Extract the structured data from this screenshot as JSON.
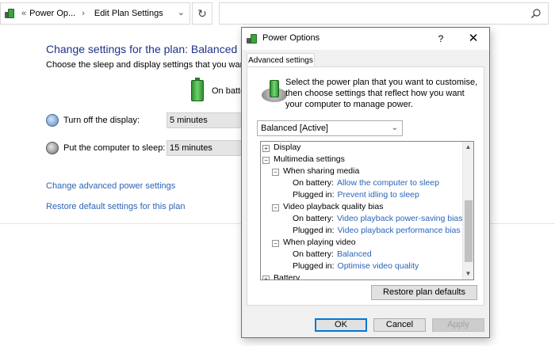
{
  "address_bar": {
    "breadcrumb_overflow": "«",
    "breadcrumb_parent": "Power Op...",
    "breadcrumb_sep": "›",
    "breadcrumb_current": "Edit Plan Settings",
    "dropdown_glyph": "⌄",
    "refresh_glyph": "↻"
  },
  "plan": {
    "title": "Change settings for the plan: Balanced",
    "subtitle": "Choose the sleep and display settings that you want yo",
    "on_battery_label": "On batte",
    "display_label": "Turn off the display:",
    "display_value": "5 minutes",
    "sleep_label": "Put the computer to sleep:",
    "sleep_value": "15 minutes",
    "advanced_link": "Change advanced power settings",
    "restore_link": "Restore default settings for this plan"
  },
  "dialog": {
    "title": "Power Options",
    "help_glyph": "?",
    "close_glyph": "✕",
    "tab": "Advanced settings",
    "intro": "Select the power plan that you want to customise, then choose settings that reflect how you want your computer to manage power.",
    "plan_selected": "Balanced [Active]",
    "plan_dropdown_glyph": "⌄",
    "tree": [
      {
        "level": 0,
        "expander": "+",
        "label": "Display",
        "value": ""
      },
      {
        "level": 0,
        "expander": "−",
        "label": "Multimedia settings",
        "value": ""
      },
      {
        "level": 1,
        "expander": "−",
        "label": "When sharing media",
        "value": ""
      },
      {
        "level": 2,
        "expander": "",
        "label": "On battery:",
        "value": "Allow the computer to sleep"
      },
      {
        "level": 2,
        "expander": "",
        "label": "Plugged in:",
        "value": "Prevent idling to sleep"
      },
      {
        "level": 1,
        "expander": "−",
        "label": "Video playback quality bias",
        "value": ""
      },
      {
        "level": 2,
        "expander": "",
        "label": "On battery:",
        "value": "Video playback power-saving bias"
      },
      {
        "level": 2,
        "expander": "",
        "label": "Plugged in:",
        "value": "Video playback performance bias"
      },
      {
        "level": 1,
        "expander": "−",
        "label": "When playing video",
        "value": ""
      },
      {
        "level": 2,
        "expander": "",
        "label": "On battery:",
        "value": "Balanced"
      },
      {
        "level": 2,
        "expander": "",
        "label": "Plugged in:",
        "value": "Optimise video quality"
      },
      {
        "level": 0,
        "expander": "+",
        "label": "Battery",
        "value": ""
      }
    ],
    "scroll_up_glyph": "▲",
    "scroll_down_glyph": "▼",
    "restore_button": "Restore plan defaults",
    "ok_button": "OK",
    "cancel_button": "Cancel",
    "apply_button": "Apply"
  },
  "colors": {
    "title_blue": "#1e3287",
    "link_blue": "#2a64b8",
    "focus_blue": "#0078d7"
  }
}
